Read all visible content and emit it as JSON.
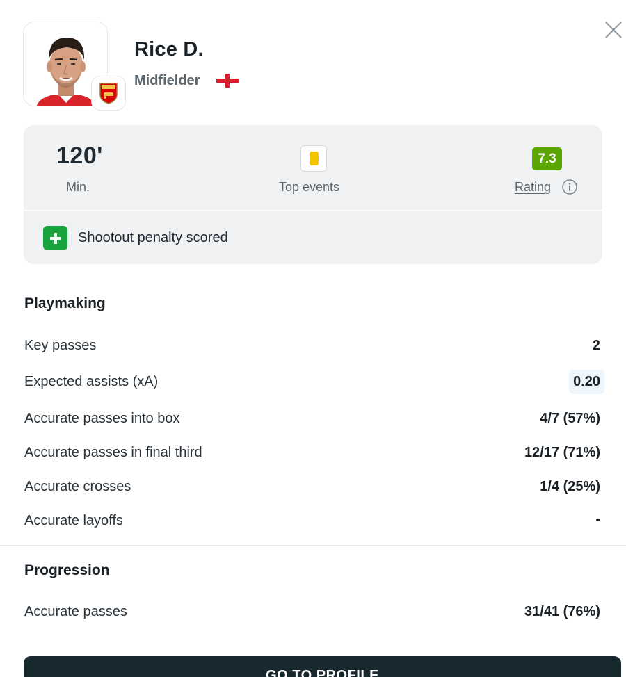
{
  "player": {
    "name": "Rice D.",
    "position": "Midfielder",
    "nationality_flag": "england-flag-icon",
    "club_badge": "arsenal-crest-icon"
  },
  "summary": {
    "minutes_value": "120'",
    "minutes_label": "Min.",
    "top_events_label": "Top events",
    "rating_value": "7.3",
    "rating_label": "Rating",
    "rating_color": "#5aa500",
    "event_text": "Shootout penalty scored",
    "event_color": "#1aa33d",
    "yellow_card_color": "#f5c400"
  },
  "playmaking": {
    "title": "Playmaking",
    "rows": [
      {
        "label": "Key passes",
        "value": "2"
      },
      {
        "label": "Expected assists (xA)",
        "value": "0.20"
      },
      {
        "label": "Accurate passes into box",
        "value": "4/7 (57%)"
      },
      {
        "label": "Accurate passes in final third",
        "value": "12/17 (71%)"
      },
      {
        "label": "Accurate crosses",
        "value": "1/4 (25%)"
      },
      {
        "label": "Accurate layoffs",
        "value": "-"
      }
    ]
  },
  "progression": {
    "title": "Progression",
    "rows": [
      {
        "label": "Accurate passes",
        "value": "31/41 (76%)"
      }
    ]
  },
  "footer": {
    "profile_button_label": "GO TO PROFILE",
    "button_color": "#18282f"
  }
}
